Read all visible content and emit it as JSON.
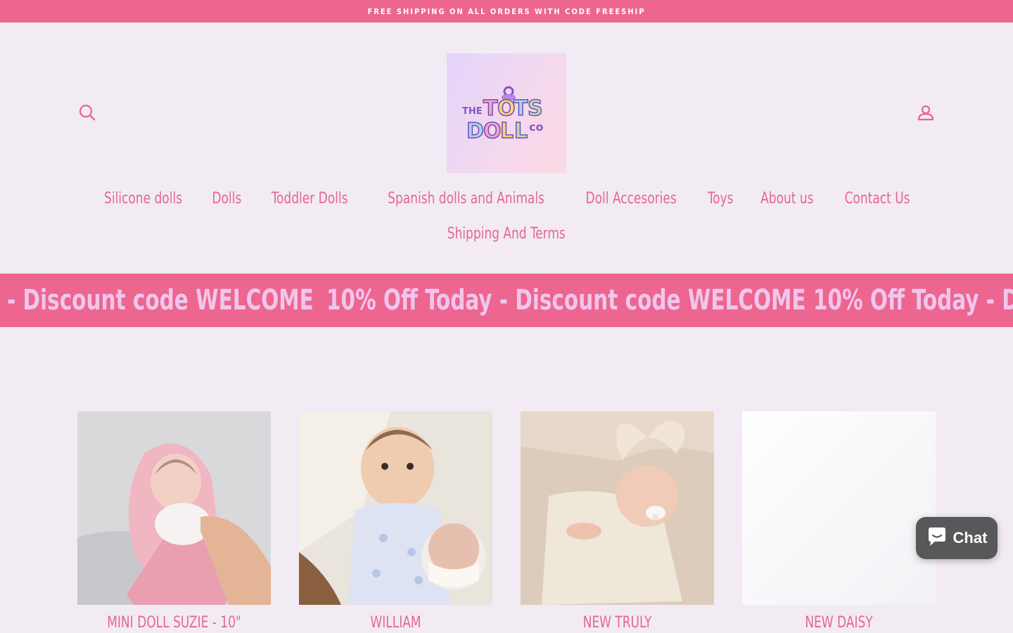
{
  "announcement": {
    "text": "FREE SHIPPING ON ALL ORDERS WITH CODE FREESHIP"
  },
  "header": {
    "logo_text_1": "THE TOTS",
    "logo_text_2": "DOLL CO",
    "nav": [
      "Silicone dolls",
      "Dolls",
      "Toddler Dolls",
      "Spanish dolls and Animals",
      "Doll Accesories",
      "Toys",
      "About us",
      "Contact Us",
      "Shipping And Terms"
    ]
  },
  "marquee": {
    "lead": "- Discount code WELCOME",
    "item": "10% Off Today - Discount code WELCOME",
    "tail": "10% Off Today - D"
  },
  "products": [
    {
      "title": "MINI DOLL SUZIE - 10\""
    },
    {
      "title": "WILLIAM"
    },
    {
      "title": "NEW TRULY"
    },
    {
      "title": "NEW DAISY"
    }
  ],
  "chat": {
    "label": "Chat"
  },
  "colors": {
    "brand_pink": "#ec6690",
    "nav_pink": "#e66693",
    "background": "#f2ebf4",
    "chat_bg": "#58585a"
  }
}
